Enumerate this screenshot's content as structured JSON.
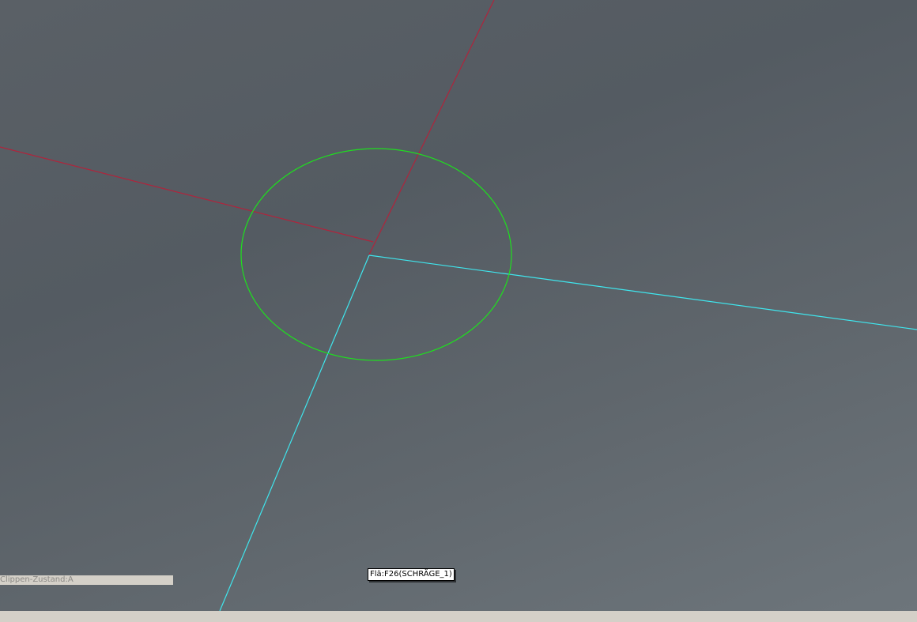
{
  "viewport": {
    "status_text": "Clippen-Zustand:A",
    "hover_tooltip": "Flä:F26(SCHRÄGE_1)"
  },
  "colors": {
    "background_top": "#545b62",
    "background_bottom": "#6d757b",
    "x_axis": "#b0243c",
    "y_axis": "#3fe6ee",
    "circle": "#1ee01e",
    "status_bar_bg": "#d4d0c8"
  }
}
